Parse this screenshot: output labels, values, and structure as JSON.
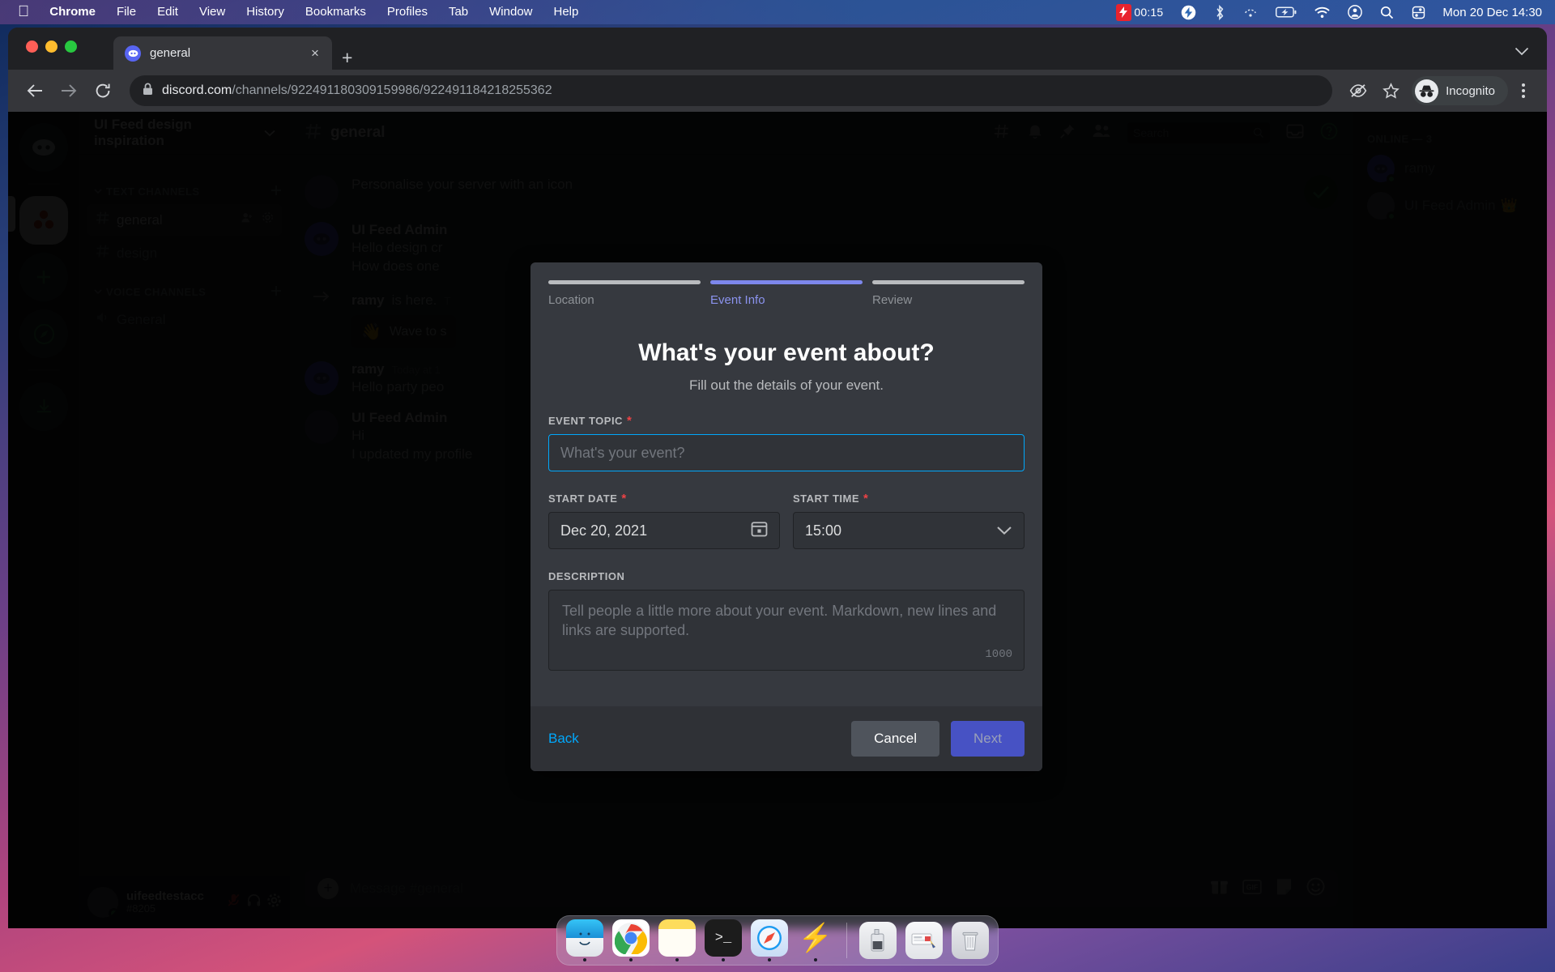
{
  "menubar": {
    "apple_icon": "apple-logo",
    "items": [
      "Chrome",
      "File",
      "Edit",
      "View",
      "History",
      "Bookmarks",
      "Profiles",
      "Tab",
      "Window",
      "Help"
    ],
    "recording_time": "00:15",
    "status_icons": [
      "bolt-icon",
      "bluetooth-icon",
      "airdrop-icon",
      "battery-charging-icon",
      "wifi-icon",
      "user-account-icon",
      "search-icon",
      "control-center-icon"
    ],
    "clock": "Mon 20 Dec  14:30"
  },
  "browser": {
    "tab": {
      "title": "general",
      "favicon": "discord-icon",
      "close": "×"
    },
    "new_tab": "+",
    "url": {
      "host": "discord.com",
      "path": "/channels/922491180309159986/922491184218255362"
    },
    "profile_label": "Incognito",
    "toolbar_icons": [
      "back-arrow-icon",
      "forward-arrow-icon",
      "reload-icon",
      "lock-icon",
      "hide-icon",
      "bookmark-star-icon",
      "incognito-icon",
      "chrome-menu-icon"
    ]
  },
  "discord": {
    "server_name": "UI Feed design inspiration",
    "categories": [
      {
        "name": "TEXT CHANNELS",
        "channels": [
          {
            "name": "general",
            "icon": "hash-icon",
            "selected": true
          },
          {
            "name": "design",
            "icon": "hash-icon",
            "selected": false
          }
        ]
      },
      {
        "name": "VOICE CHANNELS",
        "channels": [
          {
            "name": "General",
            "icon": "speaker-icon",
            "selected": false
          }
        ]
      }
    ],
    "user_panel": {
      "username": "uifeedtestacc",
      "discriminator": "#8205"
    },
    "channel_header": {
      "name": "general"
    },
    "search_placeholder": "Search",
    "banner_text": "Personalise your server with an icon",
    "messages": [
      {
        "type": "message",
        "author": "UI Feed Admin",
        "time": "",
        "lines": [
          "Hello design cr",
          "How does one"
        ]
      },
      {
        "type": "system",
        "author": "ramy",
        "text": "is here.",
        "time": "T",
        "card": "Wave to s"
      },
      {
        "type": "message",
        "author": "ramy",
        "time": "Today at 1",
        "lines": [
          "Hello party peo"
        ]
      },
      {
        "type": "message",
        "author": "UI Feed Admin",
        "time": "",
        "lines": [
          "Hi",
          "I updated my profile"
        ]
      }
    ],
    "composer_placeholder": "Message #general",
    "composer_icons": [
      "gift-icon",
      "gif-icon",
      "sticker-icon",
      "emoji-icon"
    ],
    "members": {
      "header": "ONLINE — 3",
      "list": [
        {
          "name": "ramy",
          "crown": false
        },
        {
          "name": "UI Feed Admin",
          "crown": true
        }
      ]
    }
  },
  "modal": {
    "steps": [
      {
        "label": "Location",
        "active": false
      },
      {
        "label": "Event Info",
        "active": true
      },
      {
        "label": "Review",
        "active": false
      }
    ],
    "title": "What's your event about?",
    "subtitle": "Fill out the details of your event.",
    "fields": {
      "topic": {
        "label": "EVENT TOPIC",
        "required": "*",
        "value": "",
        "placeholder": "What's your event?"
      },
      "start_date": {
        "label": "START DATE",
        "required": "*",
        "value": "Dec 20, 2021",
        "icon": "calendar-icon"
      },
      "start_time": {
        "label": "START TIME",
        "required": "*",
        "value": "15:00",
        "icon": "chevron-down-icon"
      },
      "description": {
        "label": "DESCRIPTION",
        "value": "",
        "placeholder": "Tell people a little more about your event. Markdown, new lines and links are supported.",
        "counter": "1000"
      }
    },
    "buttons": {
      "back": "Back",
      "cancel": "Cancel",
      "next": "Next"
    },
    "colors": {
      "accent": "#5865f2",
      "next_button": "#4752c4",
      "link": "#00a8fc",
      "required": "#ed4245",
      "focus_border": "#00a8fc"
    }
  },
  "dock": {
    "apps": [
      {
        "name": "Finder",
        "icon": "finder-icon"
      },
      {
        "name": "Google Chrome",
        "icon": "chrome-icon"
      },
      {
        "name": "Notes",
        "icon": "notes-icon"
      },
      {
        "name": "Terminal",
        "icon": "terminal-icon"
      },
      {
        "name": "Safari",
        "icon": "safari-icon"
      },
      {
        "name": "Lightning",
        "icon": "bolt-icon"
      }
    ],
    "utilities": [
      {
        "name": "Cleaner",
        "icon": "cleaner-icon"
      },
      {
        "name": "Mail Attachment",
        "icon": "mail-icon"
      },
      {
        "name": "Trash",
        "icon": "trash-icon"
      }
    ]
  }
}
